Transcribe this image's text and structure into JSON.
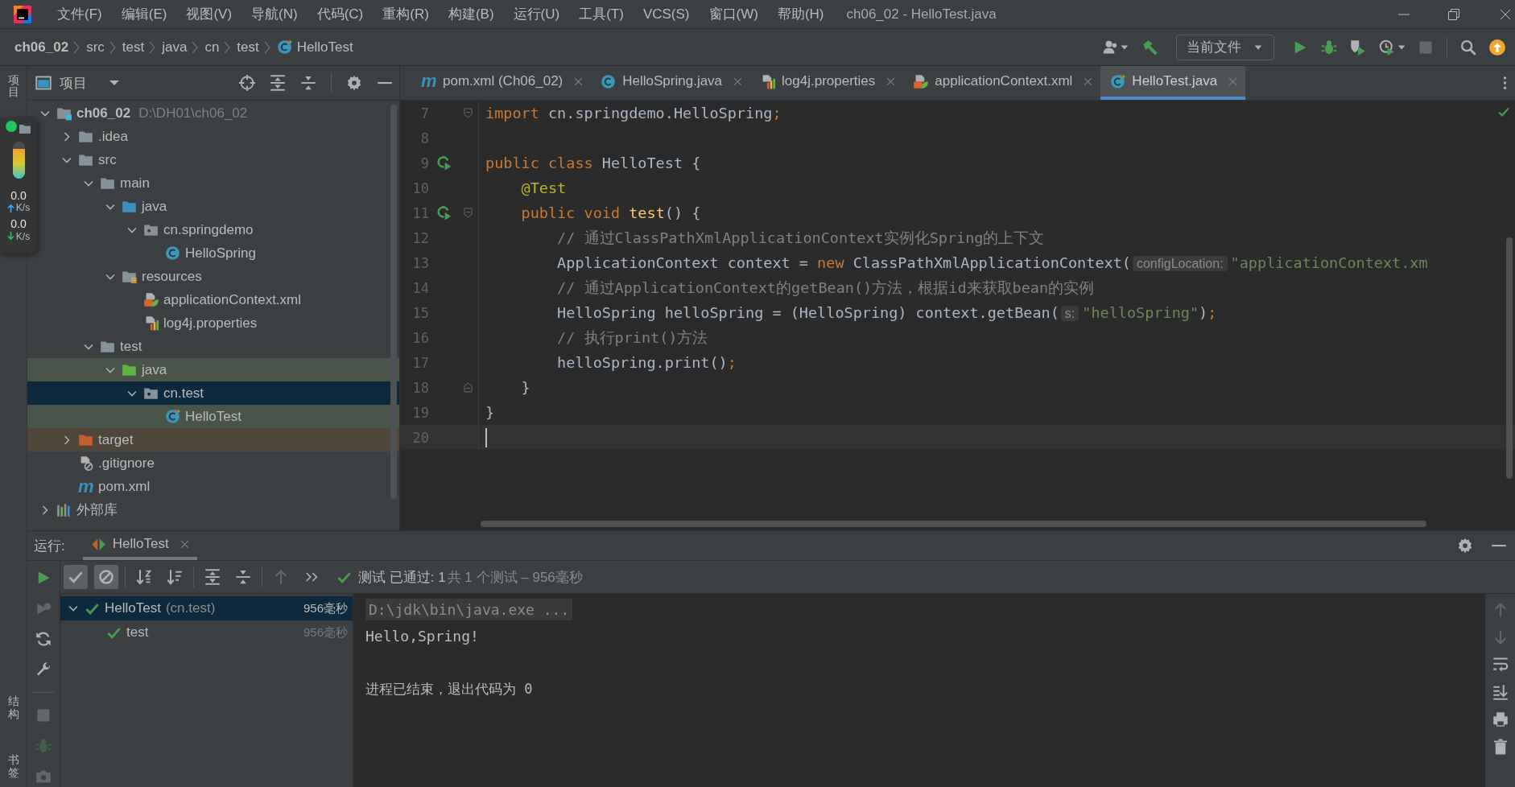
{
  "title_bar": {
    "menus": [
      "文件(F)",
      "编辑(E)",
      "视图(V)",
      "导航(N)",
      "代码(C)",
      "重构(R)",
      "构建(B)",
      "运行(U)",
      "工具(T)",
      "VCS(S)",
      "窗口(W)",
      "帮助(H)"
    ],
    "title": "ch06_02 - HelloTest.java"
  },
  "nav_bar": {
    "breadcrumbs": [
      {
        "label": "ch06_02",
        "kind": "module"
      },
      {
        "label": "src",
        "kind": "dir"
      },
      {
        "label": "test",
        "kind": "dir"
      },
      {
        "label": "java",
        "kind": "dir"
      },
      {
        "label": "cn",
        "kind": "dir"
      },
      {
        "label": "test",
        "kind": "dir"
      },
      {
        "label": "HelloTest",
        "kind": "test-class"
      }
    ],
    "tools": [
      {
        "kind": "user-menu",
        "disabled": false
      },
      {
        "kind": "build",
        "disabled": false
      }
    ],
    "run_config": "当前文件",
    "actions": [
      {
        "kind": "run",
        "disabled": false
      },
      {
        "kind": "debug",
        "disabled": false
      },
      {
        "kind": "coverage",
        "disabled": false
      },
      {
        "kind": "profile-menu",
        "disabled": false
      },
      {
        "kind": "stop",
        "disabled": true
      },
      {
        "kind": "search",
        "disabled": false
      },
      {
        "kind": "update",
        "disabled": false
      }
    ]
  },
  "left_stripe": {
    "top": [
      "项目"
    ],
    "bottom": [
      "结构",
      "书签"
    ]
  },
  "speed_widget": {
    "level": 0.8,
    "up": "0.0",
    "up_unit": "K/s",
    "down": "0.0",
    "down_unit": "K/s"
  },
  "project": {
    "title": "项目",
    "tree": [
      {
        "label": "ch06_02",
        "hint": "D:\\DH01\\ch06_02",
        "kind": "module",
        "expanded": true,
        "selected": false,
        "children": [
          {
            "label": ".idea",
            "kind": "folder",
            "expanded": false,
            "selected": false
          },
          {
            "label": "src",
            "kind": "folder",
            "expanded": true,
            "selected": false,
            "children": [
              {
                "label": "main",
                "kind": "folder",
                "expanded": true,
                "selected": false,
                "children": [
                  {
                    "label": "java",
                    "kind": "source",
                    "expanded": true,
                    "selected": false,
                    "children": [
                      {
                        "label": "cn.springdemo",
                        "kind": "package",
                        "expanded": true,
                        "selected": false,
                        "children": [
                          {
                            "label": "HelloSpring",
                            "kind": "class",
                            "selected": false
                          }
                        ]
                      }
                    ]
                  },
                  {
                    "label": "resources",
                    "kind": "resources",
                    "expanded": true,
                    "selected": false,
                    "children": [
                      {
                        "label": "applicationContext.xml",
                        "kind": "xml",
                        "selected": false
                      },
                      {
                        "label": "log4j.properties",
                        "kind": "properties",
                        "selected": false
                      }
                    ]
                  }
                ]
              },
              {
                "label": "test",
                "kind": "folder",
                "expanded": true,
                "selected": false,
                "children": [
                  {
                    "label": "java",
                    "kind": "test-source",
                    "test_scope": true,
                    "expanded": true,
                    "selected": false,
                    "children": [
                      {
                        "label": "cn.test",
                        "kind": "package",
                        "expanded": true,
                        "selected": true,
                        "children": [
                          {
                            "label": "HelloTest",
                            "kind": "test-class",
                            "test_scope": true,
                            "selected": false
                          }
                        ]
                      }
                    ]
                  }
                ]
              }
            ]
          },
          {
            "label": "target",
            "kind": "excluded",
            "excluded": true,
            "expanded": false,
            "selected": false
          },
          {
            "label": ".gitignore",
            "kind": "ignore",
            "selected": false
          },
          {
            "label": "pom.xml",
            "kind": "maven",
            "glyph": "m",
            "selected": false
          }
        ]
      },
      {
        "label": "外部库",
        "kind": "libraries",
        "expanded": false,
        "selected": false
      }
    ]
  },
  "editor": {
    "tabs": [
      {
        "label": "pom.xml (Ch06_02)",
        "kind": "maven",
        "glyph": "m",
        "selected": false
      },
      {
        "label": "HelloSpring.java",
        "kind": "class",
        "selected": false
      },
      {
        "label": "log4j.properties",
        "kind": "properties",
        "selected": false
      },
      {
        "label": "applicationContext.xml",
        "kind": "xml",
        "selected": false
      },
      {
        "label": "HelloTest.java",
        "kind": "test-class",
        "selected": true
      }
    ],
    "lines": [
      {
        "number": "7",
        "fold_start": true,
        "tokens": [
          {
            "kind": "kw",
            "text": "import"
          },
          {
            "kind": "plain",
            "text": " cn.springdemo.HelloSpring"
          },
          {
            "kind": "kw",
            "text": ";"
          }
        ]
      },
      {
        "number": "8"
      },
      {
        "number": "9",
        "runnable": true,
        "tokens": [
          {
            "kind": "kw",
            "text": "public class "
          },
          {
            "kind": "plain",
            "text": "HelloTest {"
          }
        ]
      },
      {
        "number": "10",
        "tokens": [
          {
            "kind": "ann",
            "text": "    @Test"
          }
        ]
      },
      {
        "number": "11",
        "runnable": true,
        "fold_start": true,
        "tokens": [
          {
            "kind": "kw",
            "text": "    public void "
          },
          {
            "kind": "fn",
            "text": "test"
          },
          {
            "kind": "plain",
            "text": "() {"
          }
        ]
      },
      {
        "number": "12",
        "tokens": [
          {
            "kind": "comment",
            "text": "        // 通过ClassPathXmlApplicationContext实例化Spring的上下文"
          }
        ]
      },
      {
        "number": "13",
        "tokens": [
          {
            "kind": "plain",
            "text": "        ApplicationContext context = "
          },
          {
            "kind": "kw",
            "text": "new "
          },
          {
            "kind": "plain",
            "text": "ClassPathXmlApplicationContext("
          },
          {
            "kind": "hint",
            "text": "configLocation:"
          },
          {
            "kind": "str",
            "text": "\"applicationContext.xm"
          }
        ]
      },
      {
        "number": "14",
        "tokens": [
          {
            "kind": "comment",
            "text": "        // 通过ApplicationContext的getBean()方法，根据id来获取bean的实例"
          }
        ]
      },
      {
        "number": "15",
        "tokens": [
          {
            "kind": "plain",
            "text": "        HelloSpring helloSpring = (HelloSpring) context.getBean("
          },
          {
            "kind": "hint",
            "text": "s:"
          },
          {
            "kind": "str",
            "text": "\"helloSpring\""
          },
          {
            "kind": "plain",
            "text": ")"
          },
          {
            "kind": "kw",
            "text": ";"
          }
        ]
      },
      {
        "number": "16",
        "tokens": [
          {
            "kind": "comment",
            "text": "        // 执行print()方法"
          }
        ]
      },
      {
        "number": "17",
        "tokens": [
          {
            "kind": "plain",
            "text": "        helloSpring.print()"
          },
          {
            "kind": "kw",
            "text": ";"
          }
        ]
      },
      {
        "number": "18",
        "fold_end": true,
        "tokens": [
          {
            "kind": "plain",
            "text": "    }"
          }
        ]
      },
      {
        "number": "19",
        "tokens": [
          {
            "kind": "plain",
            "text": "}"
          }
        ]
      },
      {
        "number": "20",
        "current": true
      }
    ]
  },
  "run_panel": {
    "label": "运行:",
    "tabs": [
      {
        "label": "HelloTest",
        "selected": true
      }
    ],
    "side_tools": [
      {
        "kind": "rerun",
        "disabled": false
      },
      {
        "kind": "rerun-failed",
        "disabled": true
      },
      {
        "kind": "auto-test",
        "disabled": false
      },
      {
        "kind": "settings",
        "disabled": false
      },
      {
        "kind": "separator"
      },
      {
        "kind": "stop",
        "disabled": true
      },
      {
        "kind": "debug",
        "disabled": true
      },
      {
        "kind": "camera",
        "disabled": true
      }
    ],
    "toolbar": [
      {
        "kind": "show-passed",
        "pressed": true,
        "disabled": false
      },
      {
        "kind": "show-ignored",
        "pressed": true,
        "disabled": false
      },
      {
        "kind": "separator"
      },
      {
        "kind": "sort-alpha",
        "pressed": false,
        "disabled": false
      },
      {
        "kind": "sort-duration",
        "pressed": false,
        "disabled": false
      },
      {
        "kind": "separator"
      },
      {
        "kind": "expand-all",
        "pressed": false,
        "disabled": false
      },
      {
        "kind": "collapse-all",
        "pressed": false,
        "disabled": false
      },
      {
        "kind": "separator"
      },
      {
        "kind": "previous",
        "pressed": false,
        "disabled": true
      },
      {
        "kind": "more",
        "pressed": false,
        "disabled": false
      }
    ],
    "status": {
      "passed": true,
      "result": "测试 已通过: 1",
      "summary": "共 1 个测试 – 956毫秒"
    },
    "tests": [
      {
        "label": "HelloTest",
        "package": "(cn.test)",
        "time": "956毫秒",
        "passed": true,
        "expanded": true,
        "selected": true,
        "children": [
          {
            "label": "test",
            "time": "956毫秒",
            "passed": true,
            "selected": false
          }
        ]
      }
    ],
    "console": [
      {
        "kind": "command",
        "text": "D:\\jdk\\bin\\java.exe ..."
      },
      {
        "kind": "output",
        "text": "Hello,Spring!"
      },
      {
        "kind": "blank"
      },
      {
        "kind": "system",
        "text": "进程已结束，退出代码为 0"
      }
    ],
    "console_tools": [
      {
        "kind": "previous",
        "disabled": true
      },
      {
        "kind": "next",
        "disabled": true
      },
      {
        "kind": "soft-wrap",
        "disabled": false
      },
      {
        "kind": "scroll-end",
        "disabled": false
      },
      {
        "kind": "print",
        "disabled": false
      },
      {
        "kind": "clear",
        "disabled": false
      }
    ]
  }
}
